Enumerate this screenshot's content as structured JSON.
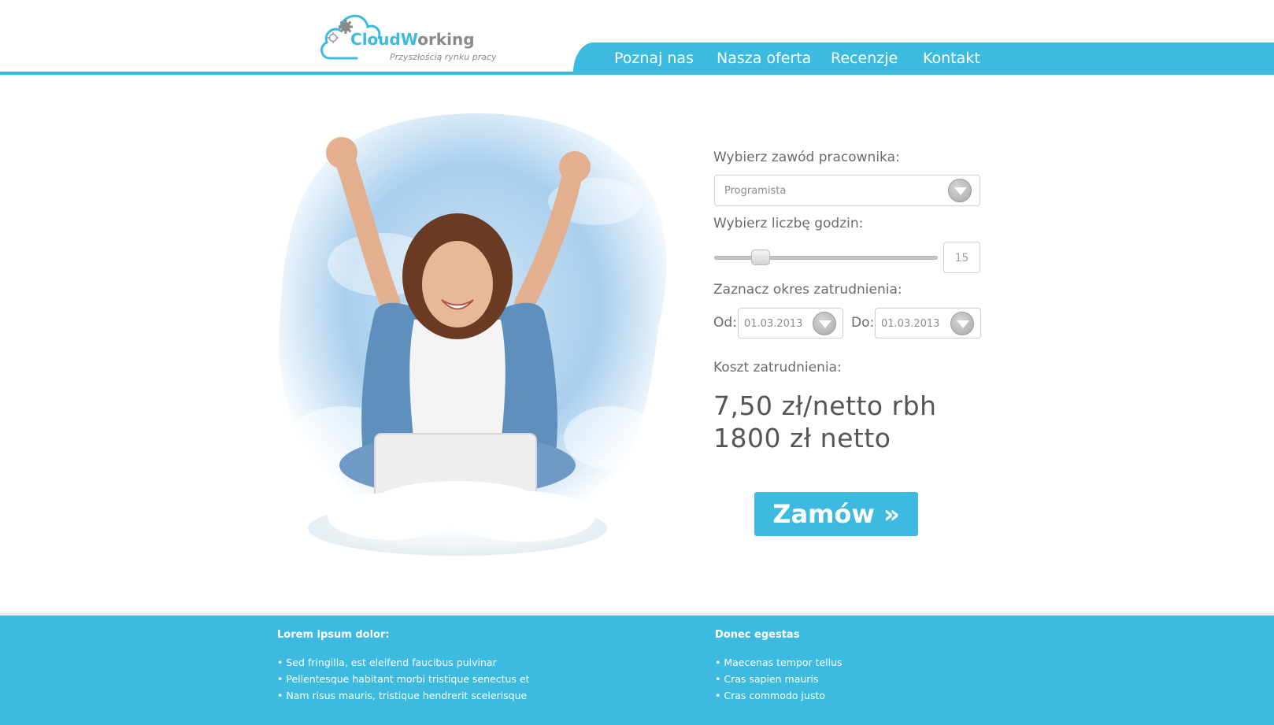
{
  "logo": {
    "brand_cloud": "Cloud",
    "brand_working": "Working",
    "brand_cloud_initial": "C",
    "brand_cloud_rest": "loud",
    "brand_working_initial": "W",
    "brand_working_rest": "orking",
    "tagline": "Przyszłością rynku pracy"
  },
  "nav": {
    "items": [
      {
        "label": "Poznaj nas"
      },
      {
        "label": "Nasza oferta"
      },
      {
        "label": "Recenzje"
      },
      {
        "label": "Kontakt"
      }
    ]
  },
  "form": {
    "profession_label": "Wybierz zawód pracownika:",
    "profession_value": "Programista",
    "hours_label": "Wybierz liczbę godzin:",
    "hours_value": "15",
    "hours_slider_fraction": 0.18,
    "period_label": "Zaznacz okres zatrudnienia:",
    "from_label": "Od:",
    "from_value": "01.03.2013",
    "to_label": "Do:",
    "to_value": "01.03.2013",
    "cost_label": "Koszt zatrudnienia:",
    "price_hourly": "7,50 zł/netto rbh",
    "price_total": "1800 zł netto",
    "order_button": "Zamów »"
  },
  "footer": {
    "left": {
      "heading": "Lorem ipsum dolor:",
      "items": [
        "• Sed fringilla, est eleifend faucibus pulvinar",
        "• Pellentesque habitant morbi tristique senectus et",
        "• Nam risus mauris, tristique hendrerit scelerisque"
      ]
    },
    "right": {
      "heading": "Donec egestas",
      "items": [
        "• Maecenas tempor tellus",
        "• Cras sapien mauris",
        "•  Cras commodo justo"
      ]
    }
  },
  "colors": {
    "accent": "#3cbadf",
    "text": "#555555",
    "muted": "#8c8c8c"
  }
}
